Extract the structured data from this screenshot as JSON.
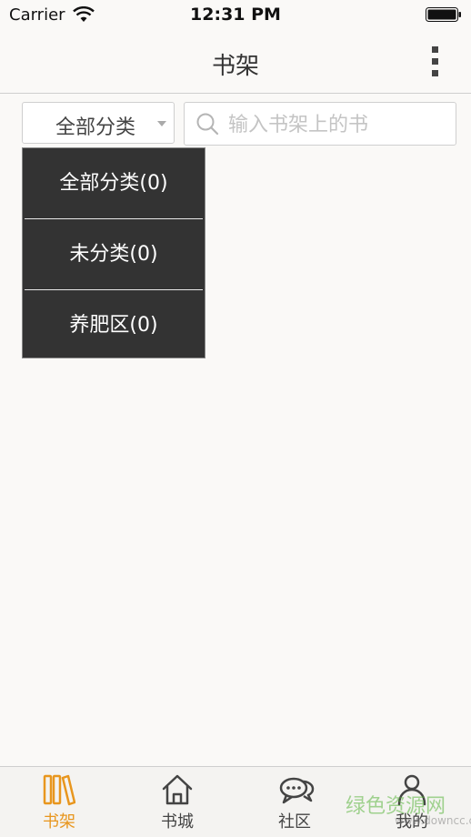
{
  "status_bar": {
    "carrier": "Carrier",
    "time": "12:31 PM"
  },
  "navbar": {
    "title": "书架",
    "more_icon": "more-vertical-icon"
  },
  "filter": {
    "selected": "全部分类",
    "options": [
      {
        "label": "全部分类(0)"
      },
      {
        "label": "未分类(0)"
      },
      {
        "label": "养肥区(0)"
      }
    ]
  },
  "search": {
    "placeholder": "输入书架上的书",
    "value": ""
  },
  "tabbar": {
    "tabs": [
      {
        "label": "书架",
        "icon": "bookshelf-icon",
        "active": true
      },
      {
        "label": "书城",
        "icon": "home-icon",
        "active": false
      },
      {
        "label": "社区",
        "icon": "chat-bubbles-icon",
        "active": false
      },
      {
        "label": "我的",
        "icon": "person-icon",
        "active": false
      }
    ]
  },
  "watermark": {
    "text": "绿色资源网",
    "sub": "www.downcc.com"
  },
  "colors": {
    "accent": "#e8961e",
    "background": "#faf9f7",
    "dropdown_bg": "#333333"
  }
}
